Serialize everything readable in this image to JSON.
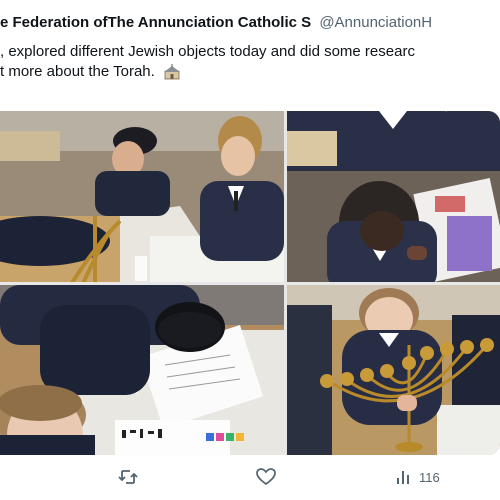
{
  "tweet": {
    "author": "e Federation ofThe Annunciation Catholic S",
    "handle": "@AnnunciationH",
    "line1": ", explored different Jewish objects today and did some researc",
    "line2": "t more about the Torah."
  },
  "media": {
    "photos": [
      "children-menorah-classroom",
      "child-writing-worksheet",
      "children-kippah-paper",
      "child-holding-menorah"
    ]
  },
  "actions": {
    "reply": "",
    "retweet": "",
    "like": "",
    "views": "116"
  },
  "icons": [
    "school-house-emoji",
    "retweet-icon",
    "heart-icon",
    "views-icon"
  ],
  "colors": {
    "text": "#0f1419",
    "muted": "#536471"
  }
}
